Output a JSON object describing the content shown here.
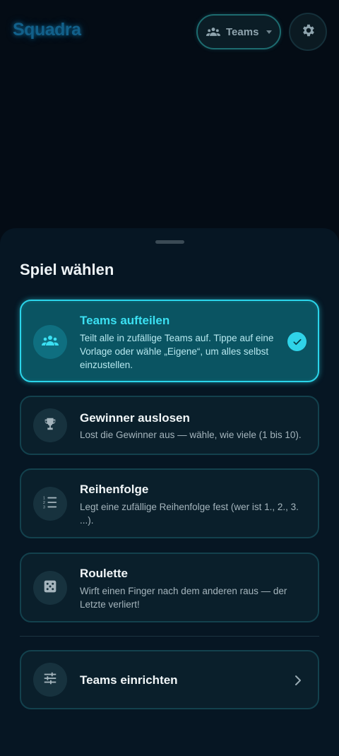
{
  "header": {
    "logo": "Squadra",
    "mode_label": "Teams",
    "mode_icon": "group-icon",
    "settings_icon": "gear-icon"
  },
  "sheet": {
    "title": "Spiel wählen",
    "games": [
      {
        "title": "Teams aufteilen",
        "description": "Teilt alle in zufällige Teams auf. Tippe auf eine Vorlage oder wähle „Eigene“, um alles selbst einzustellen.",
        "icon": "group-icon",
        "selected": true
      },
      {
        "title": "Gewinner auslosen",
        "description": "Lost die Gewinner aus — wähle, wie viele (1 bis 10).",
        "icon": "trophy-icon",
        "selected": false
      },
      {
        "title": "Reihenfolge",
        "description": "Legt eine zufällige Reihenfolge fest (wer ist 1., 2., 3. ...).",
        "icon": "numbered-list-icon",
        "selected": false
      },
      {
        "title": "Roulette",
        "description": "Wirft einen Finger nach dem anderen raus — der Letzte verliert!",
        "icon": "dice-icon",
        "selected": false
      }
    ],
    "setup": {
      "label": "Teams einrichten",
      "icon": "sliders-icon"
    }
  },
  "colors": {
    "accent": "#2bd5ea",
    "background": "#040c15",
    "sheet": "#061623",
    "logo": "#12608a"
  }
}
